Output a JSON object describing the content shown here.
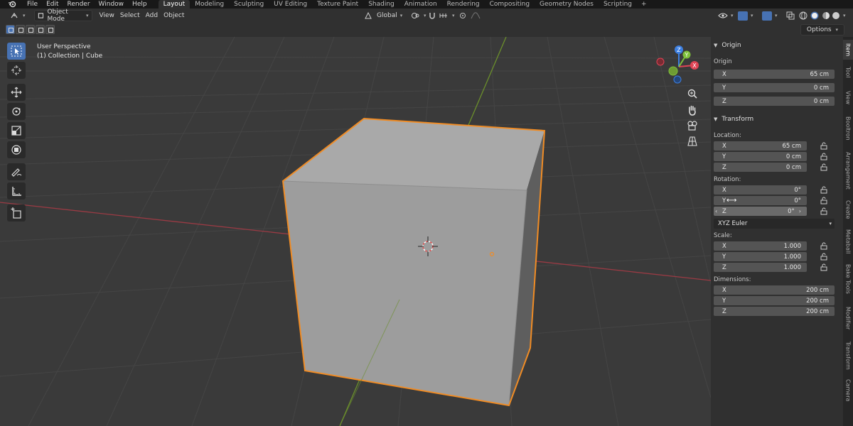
{
  "menu": [
    "File",
    "Edit",
    "Render",
    "Window",
    "Help"
  ],
  "workspaces": [
    {
      "label": "Layout",
      "active": true
    },
    {
      "label": "Modeling"
    },
    {
      "label": "Sculpting"
    },
    {
      "label": "UV Editing"
    },
    {
      "label": "Texture Paint"
    },
    {
      "label": "Shading"
    },
    {
      "label": "Animation"
    },
    {
      "label": "Rendering"
    },
    {
      "label": "Compositing"
    },
    {
      "label": "Geometry Nodes"
    },
    {
      "label": "Scripting"
    }
  ],
  "header": {
    "mode": "Object Mode",
    "view": "View",
    "select": "Select",
    "add": "Add",
    "object": "Object",
    "orientation": "Global"
  },
  "options_label": "Options",
  "overlay": {
    "perspective": "User Perspective",
    "collection": "(1) Collection | Cube"
  },
  "gizmo": {
    "z": "Z",
    "y": "Y",
    "x": "X"
  },
  "npanel": {
    "origin_section": "Origin",
    "origin_label": "Origin",
    "origin": [
      {
        "axis": "X",
        "value": "65 cm"
      },
      {
        "axis": "Y",
        "value": "0 cm"
      },
      {
        "axis": "Z",
        "value": "0 cm"
      }
    ],
    "transform_section": "Transform",
    "location_label": "Location:",
    "location": [
      {
        "axis": "X",
        "value": "65 cm"
      },
      {
        "axis": "Y",
        "value": "0 cm"
      },
      {
        "axis": "Z",
        "value": "0 cm"
      }
    ],
    "rotation_label": "Rotation:",
    "rotation": [
      {
        "axis": "X",
        "value": "0°"
      },
      {
        "axis": "Y",
        "value": "0°"
      },
      {
        "axis": "Z",
        "value": "0°"
      }
    ],
    "rotation_mode": "XYZ Euler",
    "scale_label": "Scale:",
    "scale": [
      {
        "axis": "X",
        "value": "1.000"
      },
      {
        "axis": "Y",
        "value": "1.000"
      },
      {
        "axis": "Z",
        "value": "1.000"
      }
    ],
    "dimensions_label": "Dimensions:",
    "dimensions": [
      {
        "axis": "X",
        "value": "200 cm"
      },
      {
        "axis": "Y",
        "value": "200 cm"
      },
      {
        "axis": "Z",
        "value": "200 cm"
      }
    ]
  },
  "side_tabs": [
    "Item",
    "Tool",
    "View",
    "Booltron",
    "Arrangement",
    "Create",
    "Metaball",
    "Bake Tools",
    "Modifier",
    "Transform",
    "Camera"
  ],
  "colors": {
    "select_orange": "#f08c25",
    "active_blue": "#4772b3",
    "axis_x": "#e04455",
    "axis_y": "#7ec13a",
    "axis_z": "#3d7fe0"
  }
}
